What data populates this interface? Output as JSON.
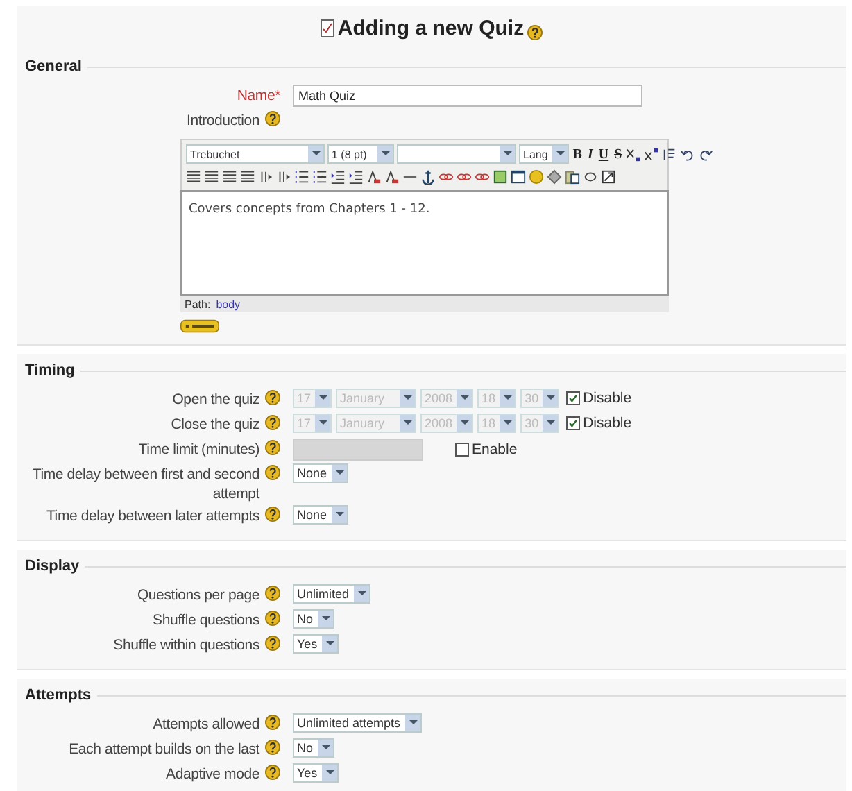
{
  "title": "Adding a new Quiz",
  "title_help": true,
  "sections": [
    {
      "legend": "General",
      "rows": [
        {
          "kind": "text",
          "label": "Name*",
          "required": true,
          "help": false,
          "value": "Math Quiz"
        },
        {
          "kind": "editor",
          "label": "Introduction",
          "help": true,
          "font": "Trebuchet",
          "size": "1 (8 pt)",
          "lang": "Lang",
          "format_buttons": [
            "B",
            "I",
            "U",
            "S"
          ],
          "content": "Covers concepts from Chapters 1 - 12.",
          "path_label": "Path:",
          "path": "body"
        }
      ]
    },
    {
      "legend": "Timing",
      "rows": [
        {
          "kind": "date",
          "label": "Open the quiz",
          "help": true,
          "disabled": true,
          "fields": [
            "17",
            "January",
            "2008",
            "18",
            "30"
          ],
          "checkbox": {
            "label": "Disable",
            "checked": true
          }
        },
        {
          "kind": "date",
          "label": "Close the quiz",
          "help": true,
          "disabled": true,
          "fields": [
            "17",
            "January",
            "2008",
            "18",
            "30"
          ],
          "checkbox": {
            "label": "Disable",
            "checked": true
          }
        },
        {
          "kind": "number",
          "label": "Time limit (minutes)",
          "help": true,
          "disabled": true,
          "checkbox": {
            "label": "Enable",
            "checked": false
          }
        },
        {
          "kind": "select",
          "label": "Time delay between first and second attempt",
          "help": true,
          "value": "None"
        },
        {
          "kind": "select",
          "label": "Time delay between later attempts",
          "help": true,
          "value": "None"
        }
      ]
    },
    {
      "legend": "Display",
      "rows": [
        {
          "kind": "select",
          "label": "Questions per page",
          "help": true,
          "value": "Unlimited"
        },
        {
          "kind": "select",
          "label": "Shuffle questions",
          "help": true,
          "value": "No"
        },
        {
          "kind": "select",
          "label": "Shuffle within questions",
          "help": true,
          "value": "Yes"
        }
      ]
    },
    {
      "legend": "Attempts",
      "rows": [
        {
          "kind": "select",
          "label": "Attempts allowed",
          "help": true,
          "value": "Unlimited attempts"
        },
        {
          "kind": "select",
          "label": "Each attempt builds on the last",
          "help": true,
          "value": "No"
        },
        {
          "kind": "select",
          "label": "Adaptive mode",
          "help": true,
          "value": "Yes"
        }
      ]
    }
  ]
}
